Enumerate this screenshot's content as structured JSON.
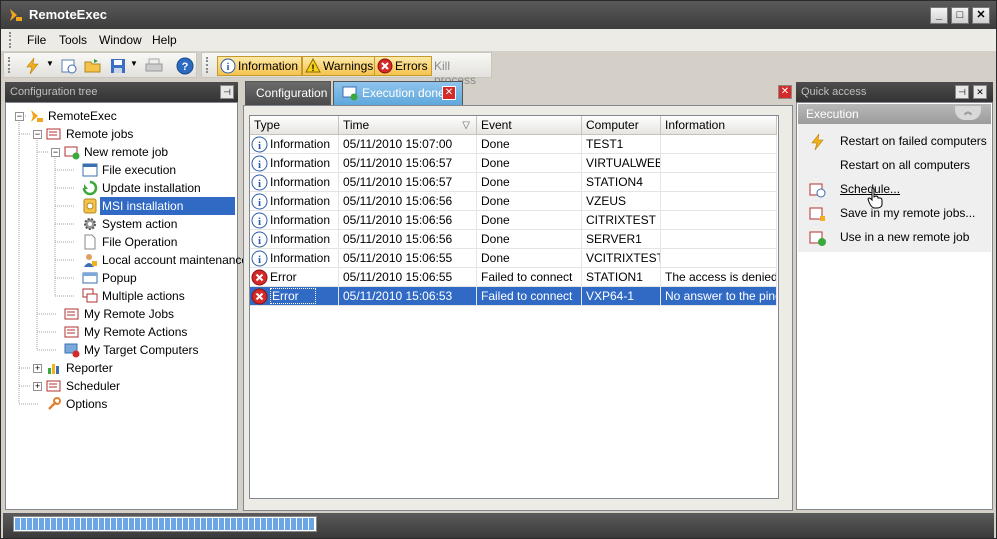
{
  "window": {
    "title": "RemoteExec",
    "minimize": "_",
    "maximize": "□",
    "close": "✕"
  },
  "menu": [
    "File",
    "Tools",
    "Window",
    "Help"
  ],
  "toolbar": {
    "filters": [
      {
        "label": "Information",
        "icon": "info-icon"
      },
      {
        "label": "Warnings",
        "icon": "warning-icon"
      },
      {
        "label": "Errors",
        "icon": "error-icon"
      }
    ],
    "kill_label": "Kill process"
  },
  "config_tree": {
    "header": "Configuration tree",
    "nodes": [
      {
        "label": "RemoteExec",
        "icon": "app-icon"
      },
      {
        "label": "Remote jobs",
        "icon": "remote-jobs-icon"
      },
      {
        "label": "New remote job",
        "icon": "new-job-icon"
      },
      {
        "label": "File execution",
        "icon": "file-execution-icon"
      },
      {
        "label": "Update installation",
        "icon": "update-icon"
      },
      {
        "label": "MSI installation",
        "icon": "msi-icon"
      },
      {
        "label": "System action",
        "icon": "gear-icon"
      },
      {
        "label": "File Operation",
        "icon": "file-icon"
      },
      {
        "label": "Local account maintenance",
        "icon": "account-icon"
      },
      {
        "label": "Popup",
        "icon": "popup-icon"
      },
      {
        "label": "Multiple actions",
        "icon": "multiple-actions-icon"
      },
      {
        "label": "My Remote Jobs",
        "icon": "my-jobs-icon"
      },
      {
        "label": "My Remote Actions",
        "icon": "my-actions-icon"
      },
      {
        "label": "My Target Computers",
        "icon": "computers-icon"
      },
      {
        "label": "Reporter",
        "icon": "reporter-icon"
      },
      {
        "label": "Scheduler",
        "icon": "scheduler-icon"
      },
      {
        "label": "Options",
        "icon": "wrench-icon"
      }
    ]
  },
  "tabs": [
    {
      "label": "Configuration"
    },
    {
      "label": "Execution done"
    }
  ],
  "grid": {
    "columns": [
      "Type",
      "Time",
      "Event",
      "Computer",
      "Information"
    ],
    "rows": [
      [
        "Information",
        "05/11/2010 15:07:00",
        "Done",
        "TEST1",
        ""
      ],
      [
        "Information",
        "05/11/2010 15:06:57",
        "Done",
        "VIRTUALWEB",
        ""
      ],
      [
        "Information",
        "05/11/2010 15:06:57",
        "Done",
        "STATION4",
        ""
      ],
      [
        "Information",
        "05/11/2010 15:06:56",
        "Done",
        "VZEUS",
        ""
      ],
      [
        "Information",
        "05/11/2010 15:06:56",
        "Done",
        "CITRIXTEST",
        ""
      ],
      [
        "Information",
        "05/11/2010 15:06:56",
        "Done",
        "SERVER1",
        ""
      ],
      [
        "Information",
        "05/11/2010 15:06:55",
        "Done",
        "VCITRIXTEST",
        ""
      ],
      [
        "Error",
        "05/11/2010 15:06:55",
        "Failed to connect",
        "STATION1",
        "The access is denied"
      ],
      [
        "Error",
        "05/11/2010 15:06:53",
        "Failed to connect",
        "VXP64-1",
        "No answer to the ping."
      ]
    ],
    "selected_row": 8
  },
  "quick_access": {
    "header": "Quick access",
    "section": "Execution",
    "items": [
      {
        "label": "Restart on failed computers",
        "icon": "lightning-icon"
      },
      {
        "label": "Restart on all computers",
        "icon": ""
      },
      {
        "label": "Schedule...",
        "icon": "schedule-icon"
      },
      {
        "label": "Save in my remote jobs...",
        "icon": "save-jobs-icon"
      },
      {
        "label": "Use in a new remote job",
        "icon": "new-remote-job-icon"
      }
    ]
  },
  "status": {
    "progress": 1.0
  },
  "colors": {
    "selection": "#316ac5",
    "tab_active": "#5ea8dc",
    "filter_button": "#f6c34e"
  }
}
